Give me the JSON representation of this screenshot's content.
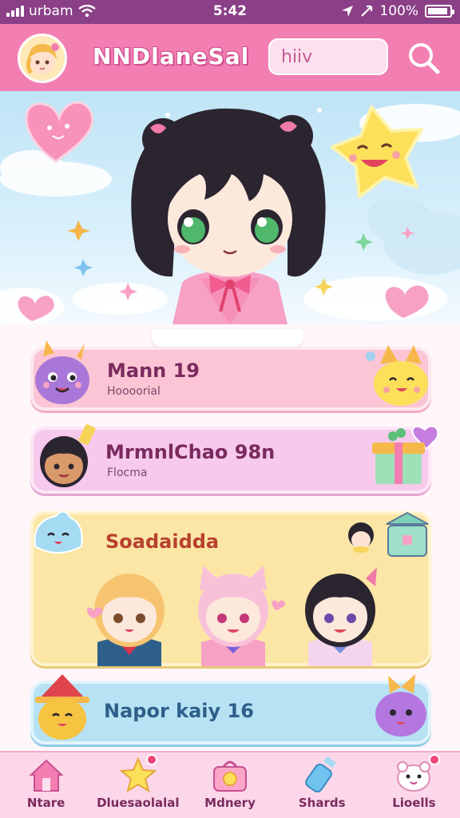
{
  "status_bar": {
    "carrier": "urbam",
    "time": "5:42",
    "battery": "100%"
  },
  "header": {
    "app_title": "NNDlaneSal",
    "search_value": "hiiv",
    "avatar_icon": "girl-avatar-icon",
    "search_icon": "search-icon"
  },
  "cards": [
    {
      "title": "Mann 19",
      "subtitle": "Hoooorial",
      "color": "#fbc5d5"
    },
    {
      "title": "MrmnlChao 98n",
      "subtitle": "Flocma",
      "color": "#f7c9ec"
    },
    {
      "title": "Soadaidda",
      "subtitle": "",
      "color": "#fbe6a6"
    },
    {
      "title": "Napor kaiy 16",
      "subtitle": "",
      "color": "#b7e2f4"
    }
  ],
  "bottom_nav": [
    {
      "label": "Ntare",
      "icon": "home-icon"
    },
    {
      "label": "Dluesaolalal",
      "icon": "star-icon"
    },
    {
      "label": "Mdnery",
      "icon": "bag-icon"
    },
    {
      "label": "Shards",
      "icon": "potion-bottle-icon"
    },
    {
      "label": "Lioells",
      "icon": "pet-icon"
    }
  ],
  "colors": {
    "header": "#f27eb2",
    "status_bar": "#8a3f86",
    "nav": "#fbd7e9",
    "text": "#7a2a5e"
  }
}
